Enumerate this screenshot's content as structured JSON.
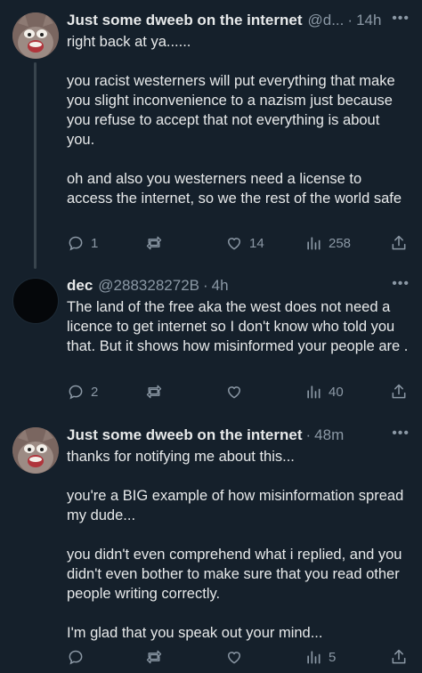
{
  "tweets": [
    {
      "name": "Just some dweeb on the internet",
      "handle": "@d...",
      "sep": "·",
      "time": "14h",
      "more": "•••",
      "paragraphs": [
        "right back at ya......",
        "you racist westerners will put everything that make you slight inconvenience to a nazism just because you refuse to accept that not everything is about you.",
        "oh and also you westerners need a license to access the internet, so we the rest of the world safe"
      ],
      "replies": "1",
      "retweets": "",
      "likes": "14",
      "views": "258"
    },
    {
      "name": "dec",
      "handle": "@288328272B",
      "sep": "·",
      "time": "4h",
      "more": "•••",
      "paragraphs": [
        "The land of the free aka the west does not need a licence to get internet so I don't know who told you that. But it shows how misinformed your people are ."
      ],
      "replies": "2",
      "retweets": "",
      "likes": "",
      "views": "40"
    },
    {
      "name": "Just some dweeb on the internet",
      "handle": "",
      "sep": "·",
      "time": "48m",
      "more": "•••",
      "paragraphs": [
        "thanks for notifying me about this...",
        "you're a BIG example of how misinformation spread my dude...",
        "you didn't even comprehend what i replied, and you didn't even bother to make sure that you read other people writing correctly.",
        "I'm glad that you speak out your mind..."
      ],
      "replies": "",
      "retweets": "",
      "likes": "",
      "views": "5"
    }
  ],
  "colors": {
    "background": "#15202b",
    "text": "#e7e9ea",
    "muted": "#8b98a5",
    "thread_line": "#38444d"
  },
  "icons": [
    "reply-icon",
    "retweet-icon",
    "like-icon",
    "views-icon",
    "share-icon",
    "more-icon"
  ]
}
